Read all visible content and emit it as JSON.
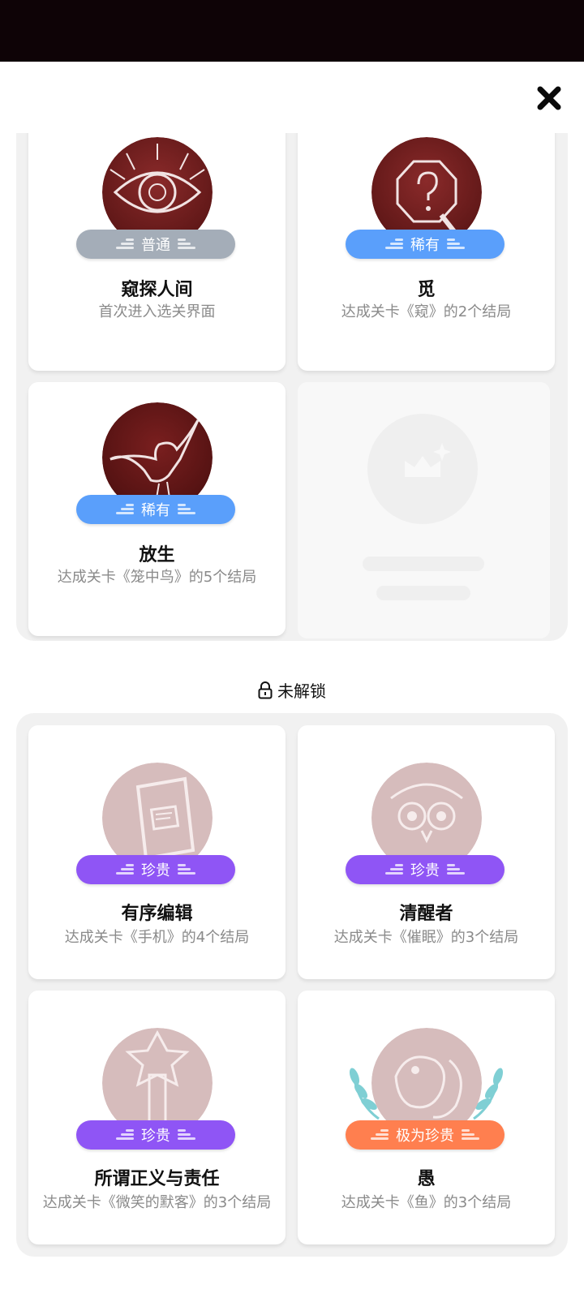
{
  "close_icon": "close-icon",
  "locked_section_label": "未解锁",
  "colors": {
    "common": "#a4adb8",
    "rare": "#5a9ffb",
    "precious": "#8f55f5",
    "extremely_precious": "#ff7f4f"
  },
  "unlocked": [
    {
      "title": "窥探人间",
      "rarity": "普通",
      "desc": "首次进入选关界面",
      "icon": "eye-icon"
    },
    {
      "title": "觅",
      "rarity": "稀有",
      "desc": "达成关卡《窥》的2个结局",
      "icon": "search-icon"
    },
    {
      "title": "放生",
      "rarity": "稀有",
      "desc": "达成关卡《笼中鸟》的5个结局",
      "icon": "bird-icon"
    }
  ],
  "locked": [
    {
      "title": "有序编辑",
      "rarity": "珍贵",
      "desc": "达成关卡《手机》的4个结局",
      "icon": "phone-icon"
    },
    {
      "title": "清醒者",
      "rarity": "珍贵",
      "desc": "达成关卡《催眠》的3个结局",
      "icon": "owl-icon"
    },
    {
      "title": "所谓正义与责任",
      "rarity": "珍贵",
      "desc": "达成关卡《微笑的默客》的3个结局",
      "icon": "wand-icon"
    },
    {
      "title": "愚",
      "rarity": "极为珍贵",
      "desc": "达成关卡《鱼》的3个结局",
      "icon": "fish-icon"
    }
  ]
}
